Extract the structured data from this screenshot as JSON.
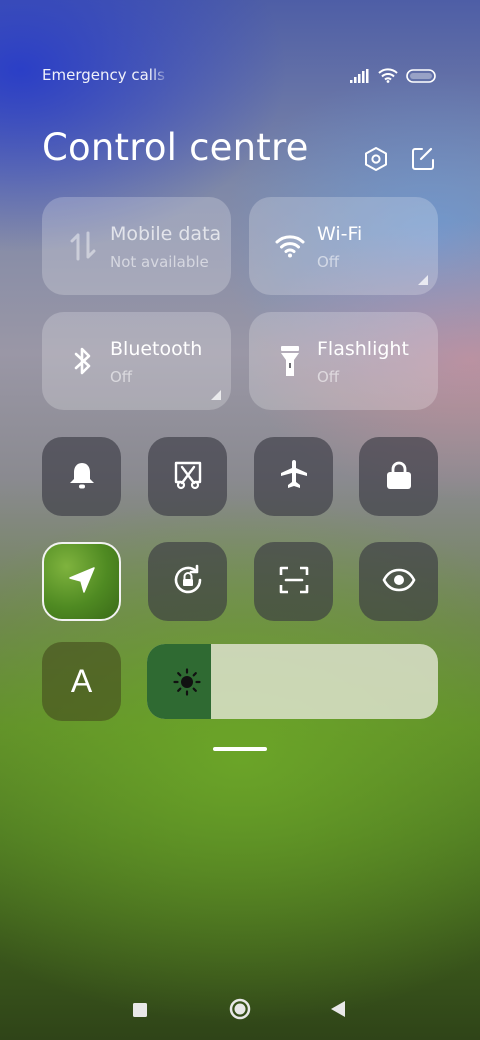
{
  "status": {
    "carrier": "Emergency calls only",
    "icons": [
      "signal-icon",
      "wifi-icon",
      "battery-icon"
    ]
  },
  "header": {
    "title": "Control centre",
    "icons": [
      "settings-icon",
      "edit-icon"
    ]
  },
  "tiles": [
    {
      "label": "Mobile data",
      "sub": "Not available",
      "icon": "mobile-data-icon"
    },
    {
      "label": "Wi-Fi",
      "sub": "Off",
      "icon": "wifi-icon"
    },
    {
      "label": "Bluetooth",
      "sub": "Off",
      "icon": "bluetooth-icon"
    },
    {
      "label": "Flashlight",
      "sub": "Off",
      "icon": "flashlight-icon"
    }
  ],
  "toggles": [
    "bell-icon",
    "screenshot-icon",
    "airplane-icon",
    "lock-icon",
    "location-icon",
    "rotation-lock-icon",
    "scan-icon",
    "eye-icon",
    "font-icon"
  ],
  "font_toggle": {
    "label": "A"
  },
  "brightness": {
    "level": 0.22,
    "icon": "sun-icon"
  },
  "nav": [
    "recents-icon",
    "home-icon",
    "back-icon"
  ]
}
